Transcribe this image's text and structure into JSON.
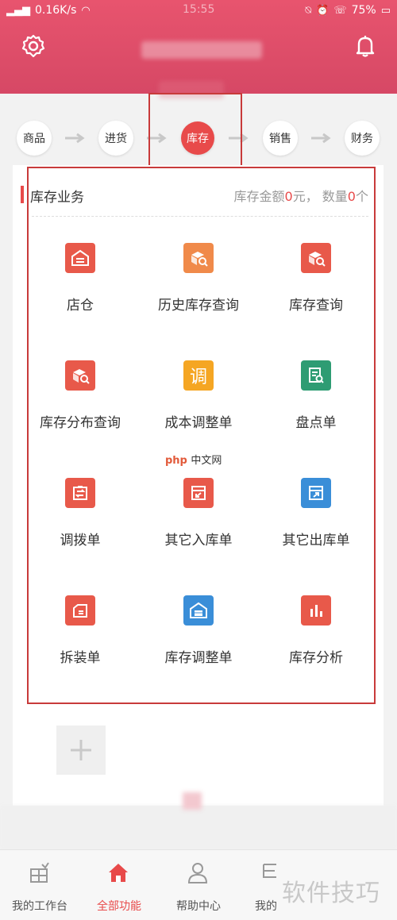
{
  "statusbar": {
    "network": "0.16K/s",
    "clock": "15:55",
    "battery": "75%"
  },
  "steps": [
    {
      "label": "商品",
      "active": false
    },
    {
      "label": "进货",
      "active": false
    },
    {
      "label": "库存",
      "active": true
    },
    {
      "label": "销售",
      "active": false
    },
    {
      "label": "财务",
      "active": false
    }
  ],
  "section": {
    "title": "库存业务",
    "info_prefix": "库存金额",
    "amount": "0",
    "info_mid": "元，  数量",
    "count": "0",
    "info_suffix": "个"
  },
  "grid": [
    {
      "label": "店仓",
      "icon": "warehouse-icon",
      "color": "#e8594a"
    },
    {
      "label": "历史库存查询",
      "icon": "history-stock-search-icon",
      "color": "#f08a4a"
    },
    {
      "label": "库存查询",
      "icon": "stock-search-icon",
      "color": "#e8594a"
    },
    {
      "label": "库存分布查询",
      "icon": "stock-distribution-icon",
      "color": "#e8594a"
    },
    {
      "label": "成本调整单",
      "icon": "cost-adjust-icon",
      "color": "#f5a623"
    },
    {
      "label": "盘点单",
      "icon": "inventory-check-icon",
      "color": "#2e9c73"
    },
    {
      "label": "调拨单",
      "icon": "transfer-icon",
      "color": "#e8594a"
    },
    {
      "label": "其它入库单",
      "icon": "other-inbound-icon",
      "color": "#e8594a"
    },
    {
      "label": "其它出库单",
      "icon": "other-outbound-icon",
      "color": "#3a8ed8"
    },
    {
      "label": "拆装单",
      "icon": "disassembly-icon",
      "color": "#e8594a"
    },
    {
      "label": "库存调整单",
      "icon": "stock-adjust-icon",
      "color": "#3a8ed8"
    },
    {
      "label": "库存分析",
      "icon": "stock-analysis-icon",
      "color": "#e8594a"
    }
  ],
  "watermark": {
    "php": "php",
    "site": "中文网",
    "corner": "软件技巧"
  },
  "nav": [
    {
      "label": "我的工作台",
      "icon": "workbench-icon",
      "active": false
    },
    {
      "label": "全部功能",
      "icon": "home-icon",
      "active": true
    },
    {
      "label": "帮助中心",
      "icon": "user-help-icon",
      "active": false
    },
    {
      "label": "我的",
      "icon": "my-icon",
      "active": false
    }
  ],
  "colors": {
    "brand": "#e84a4a",
    "header": "#e0506b"
  }
}
